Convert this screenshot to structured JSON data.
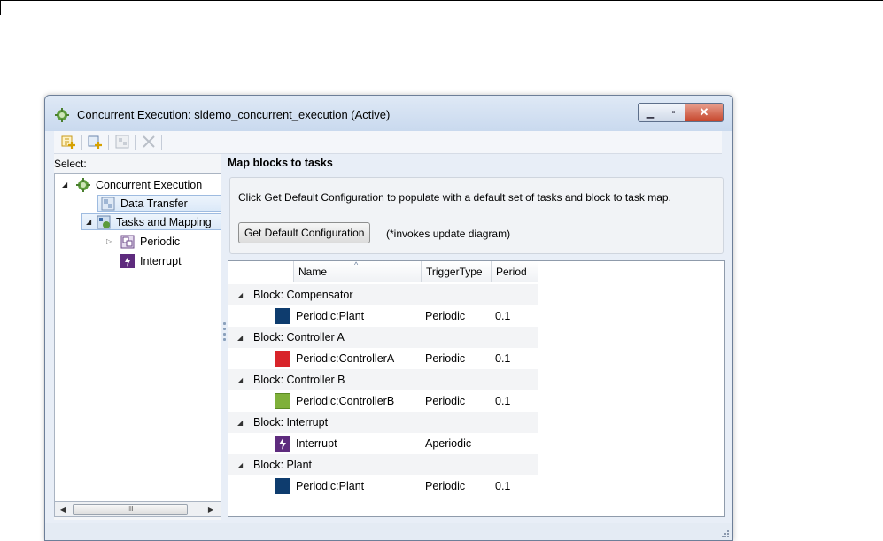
{
  "window": {
    "title": "Concurrent Execution: sldemo_concurrent_execution (Active)",
    "controls": {
      "minimize": "minimize",
      "maximize": "maximize",
      "close": "close"
    }
  },
  "toolbar": {
    "buttons": [
      {
        "icon": "add-task-icon",
        "enabled": true
      },
      {
        "icon": "add-trigger-icon",
        "enabled": true
      },
      {
        "icon": "add-mapping-icon",
        "enabled": false
      },
      {
        "icon": "delete-icon",
        "enabled": false
      }
    ]
  },
  "left": {
    "select_label": "Select:",
    "tree": [
      {
        "label": "Concurrent Execution",
        "level": 0,
        "expanded": true,
        "icon": "gear-icon"
      },
      {
        "label": "Data Transfer",
        "level": 1,
        "selected_style": true,
        "icon": "data-transfer-icon"
      },
      {
        "label": "Tasks and Mapping",
        "level": 1,
        "expanded": true,
        "selected": true,
        "icon": "task-mapping-icon"
      },
      {
        "label": "Periodic",
        "level": 2,
        "expanded": false,
        "icon": "periodic-icon"
      },
      {
        "label": "Interrupt",
        "level": 2,
        "icon": "interrupt-icon"
      }
    ],
    "scroll_thumb": "III"
  },
  "right": {
    "title": "Map blocks to tasks",
    "info_text": "Click Get Default Configuration to populate with a default set of tasks and block to task map.",
    "default_button": "Get Default Configuration",
    "note": "(*invokes update diagram)"
  },
  "table": {
    "columns": [
      "Name",
      "TriggerType",
      "Period"
    ],
    "groups": [
      {
        "label": "Block: Compensator",
        "child": {
          "name": "Periodic:Plant",
          "trigger": "Periodic",
          "period": "0.1",
          "color": "#0e3c6e"
        }
      },
      {
        "label": "Block: Controller A",
        "child": {
          "name": "Periodic:ControllerA",
          "trigger": "Periodic",
          "period": "0.1",
          "color": "#d8242a"
        }
      },
      {
        "label": "Block: Controller B",
        "child": {
          "name": "Periodic:ControllerB",
          "trigger": "Periodic",
          "period": "0.1",
          "color": "#7fb03a"
        }
      },
      {
        "label": "Block: Interrupt",
        "child": {
          "name": "Interrupt",
          "trigger": "Aperiodic",
          "period": "",
          "color": "#5e2b7e",
          "icon": "interrupt-icon"
        }
      },
      {
        "label": "Block: Plant",
        "child": {
          "name": "Periodic:Plant",
          "trigger": "Periodic",
          "period": "0.1",
          "color": "#0e3c6e"
        }
      }
    ]
  }
}
